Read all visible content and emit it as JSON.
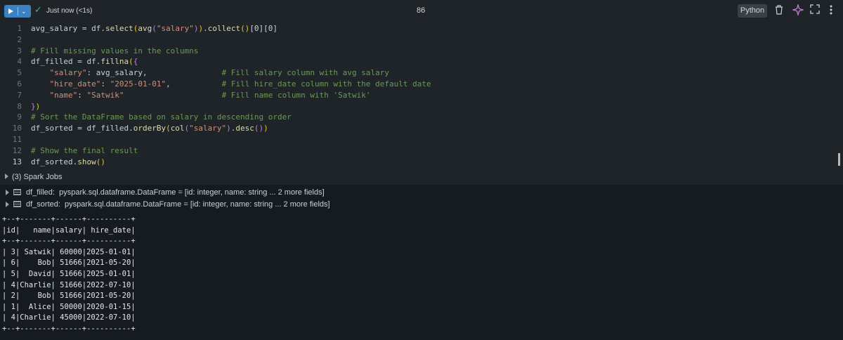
{
  "toolbar": {
    "status": "Just now (<1s)",
    "cell_number": "86",
    "language": "Python",
    "icons": [
      "play-icon",
      "chevron-down-icon",
      "check-icon",
      "trash-icon",
      "sparkle-icon",
      "expand-icon",
      "more-vertical-icon"
    ],
    "colors": {
      "run_button": "#3b82c4",
      "check": "#4ab36a"
    }
  },
  "code": {
    "lines": [
      {
        "n": "1",
        "tokens": [
          [
            "t-def",
            "avg_salary = df."
          ],
          [
            "t-fn",
            "select"
          ],
          [
            "t-paren",
            "("
          ],
          [
            "t-fn",
            "avg"
          ],
          [
            "t-paren2",
            "("
          ],
          [
            "t-str",
            "\"salary\""
          ],
          [
            "t-paren2",
            ")"
          ],
          [
            "t-paren",
            ")"
          ],
          [
            "t-def",
            "."
          ],
          [
            "t-fn",
            "collect"
          ],
          [
            "t-paren",
            "()"
          ],
          [
            "t-def",
            "[0][0]"
          ]
        ]
      },
      {
        "n": "2",
        "tokens": []
      },
      {
        "n": "3",
        "tokens": [
          [
            "t-cmt",
            "# Fill missing values in the columns"
          ]
        ]
      },
      {
        "n": "4",
        "tokens": [
          [
            "t-def",
            "df_filled = df."
          ],
          [
            "t-fn",
            "fillna"
          ],
          [
            "t-paren",
            "("
          ],
          [
            "t-paren2",
            "{"
          ]
        ]
      },
      {
        "n": "5",
        "tokens": [
          [
            "t-def",
            "    "
          ],
          [
            "t-str",
            "\"salary\""
          ],
          [
            "t-def",
            ": avg_salary,                "
          ],
          [
            "t-cmt",
            "# Fill salary column with avg salary"
          ]
        ]
      },
      {
        "n": "6",
        "tokens": [
          [
            "t-def",
            "    "
          ],
          [
            "t-str",
            "\"hire_date\""
          ],
          [
            "t-def",
            ": "
          ],
          [
            "t-str",
            "\"2025-01-01\""
          ],
          [
            "t-def",
            ",           "
          ],
          [
            "t-cmt",
            "# Fill hire_date column with the default date"
          ]
        ]
      },
      {
        "n": "7",
        "tokens": [
          [
            "t-def",
            "    "
          ],
          [
            "t-str",
            "\"name\""
          ],
          [
            "t-def",
            ": "
          ],
          [
            "t-str",
            "\"Satwik\""
          ],
          [
            "t-def",
            "                     "
          ],
          [
            "t-cmt",
            "# Fill name column with 'Satwik'"
          ]
        ]
      },
      {
        "n": "8",
        "tokens": [
          [
            "t-paren2",
            "}"
          ],
          [
            "t-paren",
            ")"
          ]
        ]
      },
      {
        "n": "9",
        "tokens": [
          [
            "t-cmt",
            "# Sort the DataFrame based on salary in descending order"
          ]
        ]
      },
      {
        "n": "10",
        "tokens": [
          [
            "t-def",
            "df_sorted = df_filled."
          ],
          [
            "t-fn",
            "orderBy"
          ],
          [
            "t-paren",
            "("
          ],
          [
            "t-fn",
            "col"
          ],
          [
            "t-paren2",
            "("
          ],
          [
            "t-str",
            "\"salary\""
          ],
          [
            "t-paren2",
            ")"
          ],
          [
            "t-def",
            "."
          ],
          [
            "t-fn",
            "desc"
          ],
          [
            "t-paren2",
            "()"
          ],
          [
            "t-paren",
            ")"
          ]
        ]
      },
      {
        "n": "11",
        "tokens": []
      },
      {
        "n": "12",
        "tokens": [
          [
            "t-cmt",
            "# Show the final result"
          ]
        ]
      },
      {
        "n": "13",
        "tokens": [
          [
            "t-def",
            "df_sorted."
          ],
          [
            "t-fn",
            "show"
          ],
          [
            "t-paren",
            "()"
          ]
        ]
      }
    ]
  },
  "spark_jobs": {
    "label": "(3) Spark Jobs"
  },
  "dataframes": [
    {
      "name": "df_filled:",
      "type": "pyspark.sql.dataframe.DataFrame = [id: integer, name: string ... 2 more fields]"
    },
    {
      "name": "df_sorted:",
      "type": "pyspark.sql.dataframe.DataFrame = [id: integer, name: string ... 2 more fields]"
    }
  ],
  "result_table": {
    "header": [
      "id",
      "name",
      "salary",
      "hire_date"
    ],
    "rows": [
      [
        "3",
        "Satwik",
        "60000",
        "2025-01-01"
      ],
      [
        "6",
        "Bob",
        "51666",
        "2021-05-20"
      ],
      [
        "5",
        "David",
        "51666",
        "2025-01-01"
      ],
      [
        "4",
        "Charlie",
        "51666",
        "2022-07-10"
      ],
      [
        "2",
        "Bob",
        "51666",
        "2021-05-20"
      ],
      [
        "1",
        "Alice",
        "50000",
        "2020-01-15"
      ],
      [
        "4",
        "Charlie",
        "45000",
        "2022-07-10"
      ]
    ]
  }
}
